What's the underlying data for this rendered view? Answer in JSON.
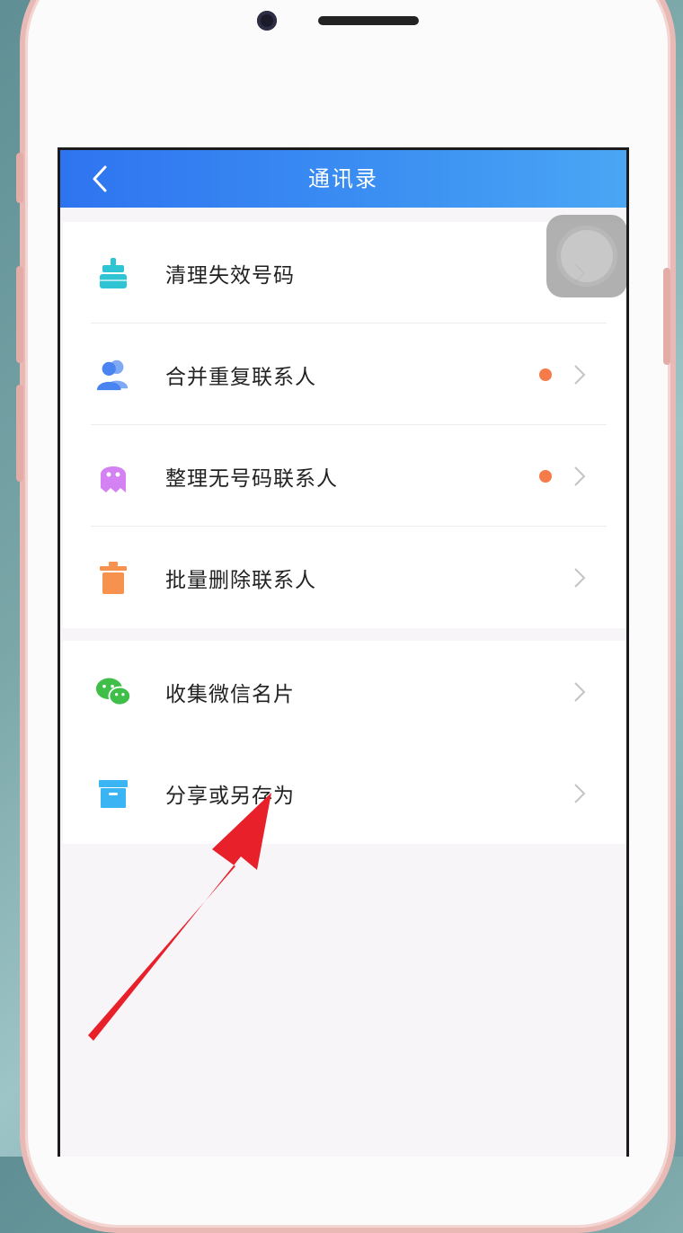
{
  "nav": {
    "title": "通讯录",
    "back_icon": "chevron-left-icon"
  },
  "groups": [
    {
      "items": [
        {
          "label": "清理失效号码",
          "icon": "broom-icon",
          "color": "#2fc4d3",
          "dot": false
        },
        {
          "label": "合并重复联系人",
          "icon": "users-icon",
          "color": "#4a84f0",
          "dot": true
        },
        {
          "label": "整理无号码联系人",
          "icon": "ghost-icon",
          "color": "#d482f3",
          "dot": true
        },
        {
          "label": "批量删除联系人",
          "icon": "trash-icon",
          "color": "#f7924e",
          "dot": false
        }
      ]
    },
    {
      "items": [
        {
          "label": "收集微信名片",
          "icon": "wechat-icon",
          "color": "#3fbf4a",
          "dot": false
        },
        {
          "label": "分享或另存为",
          "icon": "archive-box-icon",
          "color": "#3ab4f2",
          "dot": false
        }
      ]
    }
  ],
  "colors": {
    "nav_start": "#2e74f0",
    "nav_end": "#4aa6f4",
    "badge": "#f57c4a",
    "annotation_arrow": "#e8202a"
  }
}
